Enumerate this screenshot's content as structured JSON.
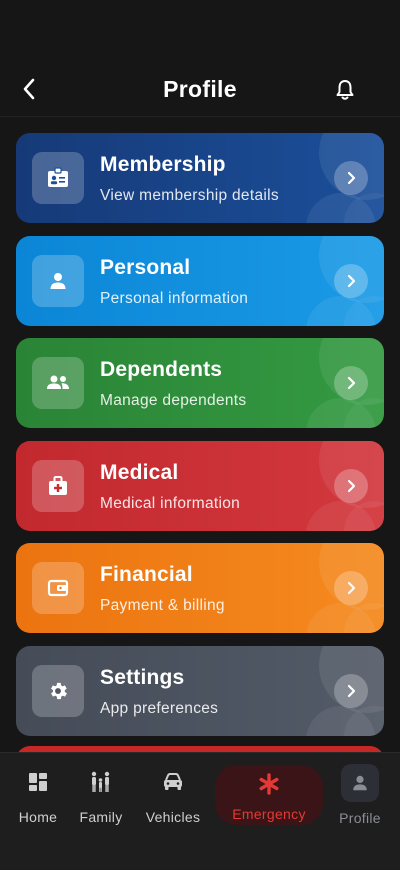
{
  "header": {
    "title": "Profile",
    "back_icon": "chevron-left-icon",
    "bell_icon": "bell-icon"
  },
  "cards": [
    {
      "id": "membership",
      "title": "Membership",
      "subtitle": "View membership details",
      "color": "#163a78",
      "icon": "id-card-icon"
    },
    {
      "id": "personal",
      "title": "Personal",
      "subtitle": "Personal information",
      "color": "#0f8fd8",
      "icon": "person-icon"
    },
    {
      "id": "dependents",
      "title": "Dependents",
      "subtitle": "Manage dependents",
      "color": "#2e8b3a",
      "icon": "group-icon"
    },
    {
      "id": "medical",
      "title": "Medical",
      "subtitle": "Medical information",
      "color": "#c92d33",
      "icon": "medical-kit-icon"
    },
    {
      "id": "financial",
      "title": "Financial",
      "subtitle": "Payment & billing",
      "color": "#ee7a12",
      "icon": "wallet-icon"
    },
    {
      "id": "settings",
      "title": "Settings",
      "subtitle": "App preferences",
      "color": "#4a5260",
      "icon": "gear-icon"
    }
  ],
  "tabbar": {
    "home": "Home",
    "family": "Family",
    "vehicles": "Vehicles",
    "emergency": "Emergency",
    "profile": "Profile",
    "emergency_color": "#e53935"
  }
}
